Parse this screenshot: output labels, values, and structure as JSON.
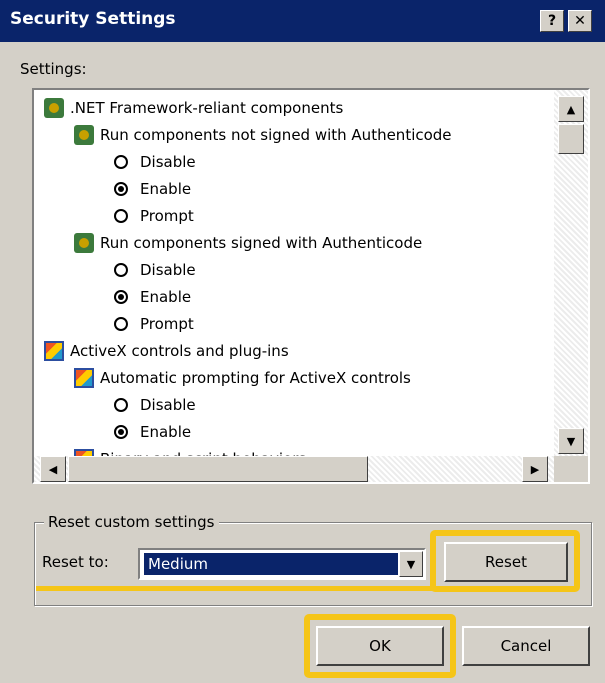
{
  "window": {
    "title": "Security Settings",
    "help_btn": "?",
    "close_btn": "✕"
  },
  "settings_label": "Settings:",
  "tree": [
    {
      "kind": "icon-gear",
      "indent": 0,
      "text": ".NET Framework-reliant components"
    },
    {
      "kind": "icon-gear",
      "indent": 1,
      "text": "Run components not signed with Authenticode"
    },
    {
      "kind": "radio",
      "indent": 2,
      "text": "Disable",
      "checked": false
    },
    {
      "kind": "radio",
      "indent": 2,
      "text": "Enable",
      "checked": true
    },
    {
      "kind": "radio",
      "indent": 2,
      "text": "Prompt",
      "checked": false
    },
    {
      "kind": "icon-gear",
      "indent": 1,
      "text": "Run components signed with Authenticode"
    },
    {
      "kind": "radio",
      "indent": 2,
      "text": "Disable",
      "checked": false
    },
    {
      "kind": "radio",
      "indent": 2,
      "text": "Enable",
      "checked": true
    },
    {
      "kind": "radio",
      "indent": 2,
      "text": "Prompt",
      "checked": false
    },
    {
      "kind": "icon-ax",
      "indent": 0,
      "text": "ActiveX controls and plug-ins"
    },
    {
      "kind": "icon-ax",
      "indent": 1,
      "text": "Automatic prompting for ActiveX controls"
    },
    {
      "kind": "radio",
      "indent": 2,
      "text": "Disable",
      "checked": false
    },
    {
      "kind": "radio",
      "indent": 2,
      "text": "Enable",
      "checked": true
    },
    {
      "kind": "icon-ax",
      "indent": 1,
      "text": "Binary and script behaviors"
    }
  ],
  "reset_group": {
    "legend": "Reset custom settings",
    "label": "Reset to:",
    "value": "Medium",
    "reset_button": "Reset"
  },
  "buttons": {
    "ok": "OK",
    "cancel": "Cancel"
  },
  "colors": {
    "titlebar": "#0a246a",
    "face": "#d4d0c8",
    "highlight": "#f5c518"
  }
}
